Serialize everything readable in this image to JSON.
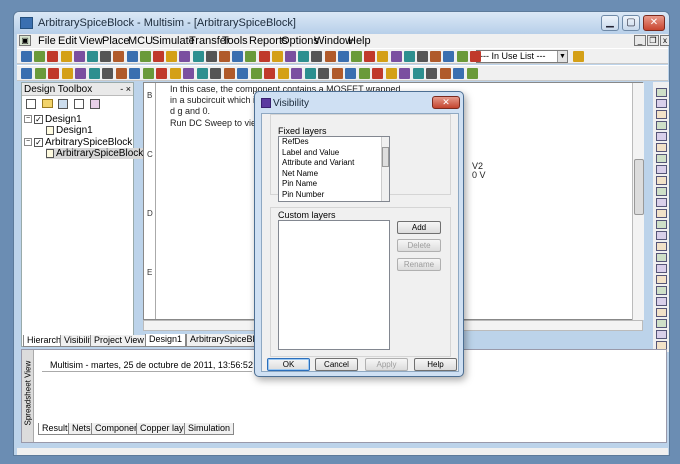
{
  "window": {
    "title": "ArbitrarySpiceBlock - Multisim - [ArbitrarySpiceBlock]"
  },
  "menubar": {
    "items": [
      "File",
      "Edit",
      "View",
      "Place",
      "MCU",
      "Simulate",
      "Transfer",
      "Tools",
      "Reports",
      "Options",
      "Window",
      "Help"
    ]
  },
  "toolbar": {
    "in_use_list": "--- In Use List ---"
  },
  "toolbox": {
    "title": "Design Toolbox",
    "tree": [
      "Design1",
      "Design1",
      "ArbitrarySpiceBlock",
      "ArbitrarySpiceBlock"
    ],
    "tabs": [
      "Hierarchy",
      "Visibility",
      "Project View"
    ]
  },
  "canvas": {
    "row_labels": [
      "B",
      "C",
      "D",
      "E"
    ],
    "text_lines": [
      "In this case, the component contains a MOSFET wrapped",
      "in a subcircuit which is conne",
      "d g and 0.",
      "Run DC Sweep to view the I/"
    ],
    "v2_label": "V2",
    "v2_value": "0  V",
    "tabs": [
      "Design1",
      "ArbitrarySpiceBlock"
    ]
  },
  "spreadsheet": {
    "side_label": "Spreadsheet View",
    "log_line": "Multisim  -  martes, 25 de octubre de 2011, 13:56:52",
    "tabs": [
      "Results",
      "Nets",
      "Components",
      "Copper layers",
      "Simulation"
    ]
  },
  "dialog": {
    "title": "Visibility",
    "fixed_label": "Fixed layers",
    "fixed_items": [
      "RefDes",
      "Label and Value",
      "Attribute and Variant",
      "Net Name",
      "Pin Name",
      "Pin Number"
    ],
    "custom_label": "Custom layers",
    "add": "Add",
    "delete": "Delete",
    "rename": "Rename",
    "ok": "OK",
    "cancel": "Cancel",
    "apply": "Apply",
    "help": "Help"
  },
  "colors": {
    "accent": "#2c6fbb",
    "title_gradient_top": "#dbe8f6",
    "close_red": "#c3442f"
  }
}
